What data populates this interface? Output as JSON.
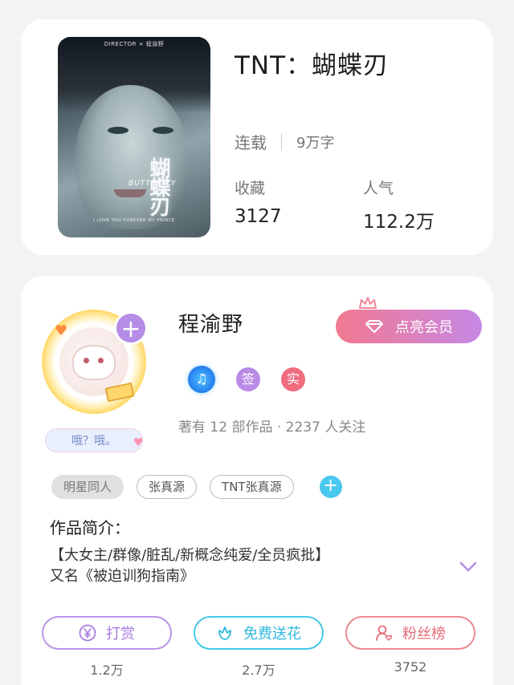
{
  "book": {
    "title": "TNT：蝴蝶刃",
    "status": "连载",
    "word_count": "9万字",
    "favorites_label": "收藏",
    "favorites_value": "3127",
    "popularity_label": "人气",
    "popularity_value": "112.2万",
    "cover": {
      "top_text": "DIRECTOR × 程渝野",
      "cn_title": "蝴蝶刃",
      "en_title": "BUTTERFLY",
      "bottom_text": "I LOVE YOU FOREVER MY PRINCE"
    }
  },
  "author": {
    "name": "程渝野",
    "bubble_text": "哦？哦。",
    "badges": [
      "签",
      "实"
    ],
    "meta": "著有 12 部作品 · 2237 人关注",
    "vip_button": "点亮会员",
    "tags": [
      "明星同人",
      "张真源",
      "TNT张真源"
    ],
    "intro_heading": "作品简介：",
    "intro_line1": "【大女主/群像/脏乱/新概念纯爱/全员疯批】",
    "intro_line2": "又名《被迫训狗指南》"
  },
  "actions": [
    {
      "label": "打赏",
      "count": "1.2万"
    },
    {
      "label": "免费送花",
      "count": "2.7万"
    },
    {
      "label": "粉丝榜",
      "count": "3752"
    }
  ],
  "colors": {
    "vip_gradient_start": "#f2798f",
    "vip_gradient_end": "#c688e4",
    "tip": "#a77be0",
    "flower": "#2fb8de",
    "fans": "#e46c78"
  }
}
